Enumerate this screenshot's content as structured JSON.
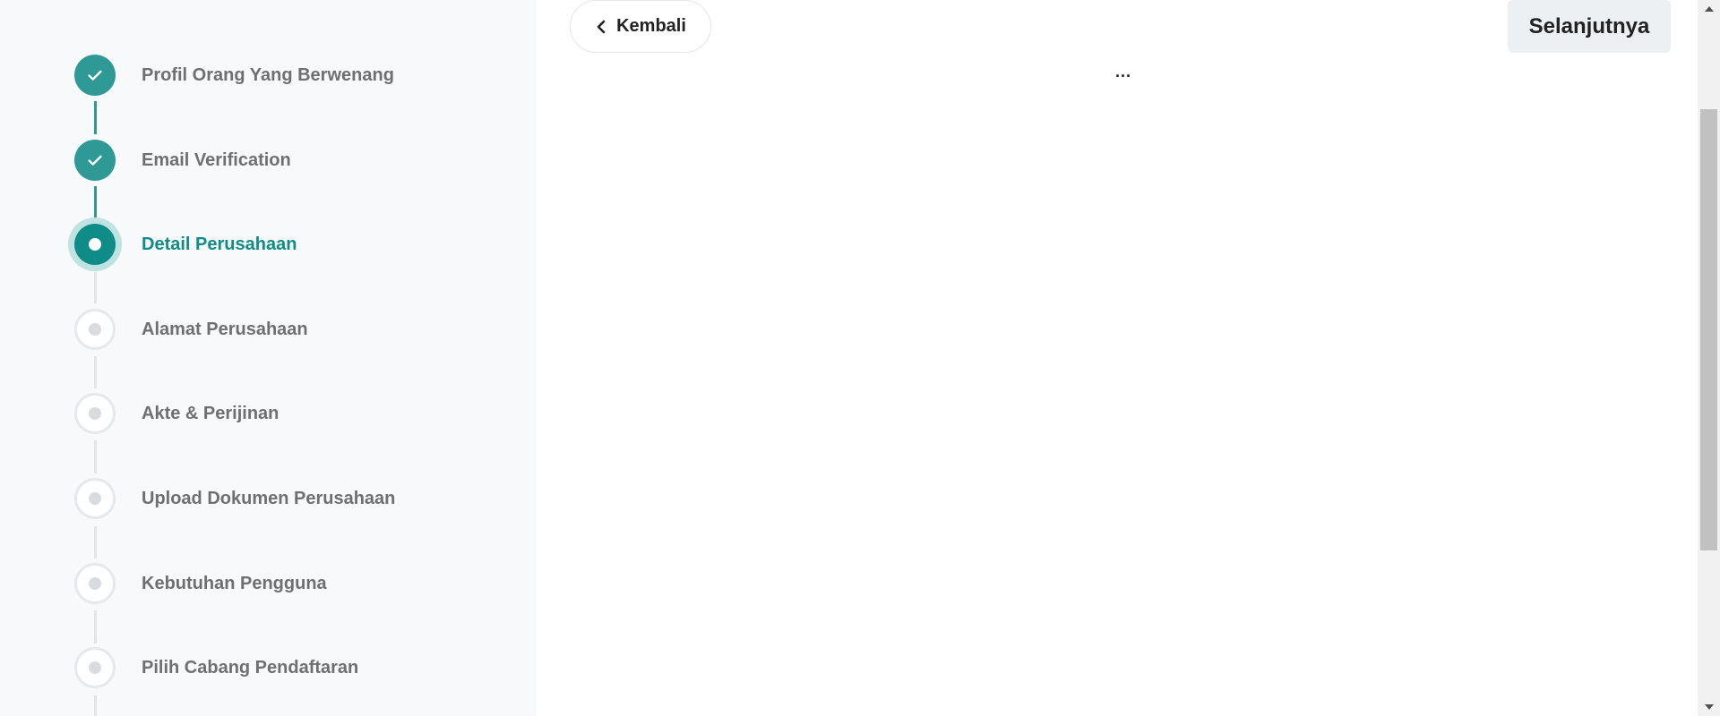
{
  "stepper": {
    "steps": [
      {
        "label": "Profil Orang Yang Berwenang",
        "status": "done"
      },
      {
        "label": "Email Verification",
        "status": "done"
      },
      {
        "label": "Detail Perusahaan",
        "status": "active"
      },
      {
        "label": "Alamat Perusahaan",
        "status": "pending"
      },
      {
        "label": "Akte & Perijinan",
        "status": "pending"
      },
      {
        "label": "Upload Dokumen Perusahaan",
        "status": "pending"
      },
      {
        "label": "Kebutuhan Pengguna",
        "status": "pending"
      },
      {
        "label": "Pilih Cabang Pendaftaran",
        "status": "pending"
      }
    ]
  },
  "main": {
    "back_label": "Kembali",
    "next_label": "Selanjutnya",
    "loading_text": "..."
  },
  "colors": {
    "accent": "#0f8c87",
    "done": "#2f9a95",
    "pending_border": "#e6e9ec"
  },
  "icons": {
    "done_step": "check-icon",
    "back": "chevron-left-icon",
    "scroll_up": "arrow-up-icon",
    "scroll_down": "arrow-down-icon"
  }
}
